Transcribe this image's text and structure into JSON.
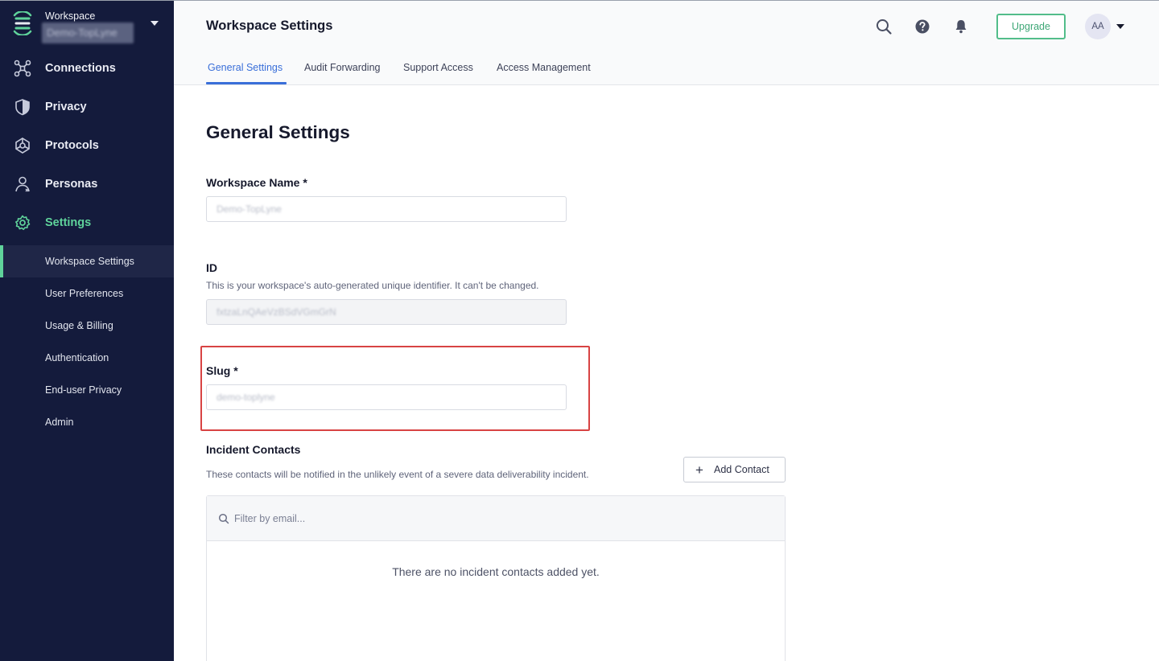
{
  "workspace": {
    "label": "Workspace",
    "name": "Demo-TopLyne"
  },
  "sidebar": {
    "nav": [
      {
        "label": "Connections"
      },
      {
        "label": "Privacy"
      },
      {
        "label": "Protocols"
      },
      {
        "label": "Personas"
      },
      {
        "label": "Settings"
      }
    ],
    "sub": [
      {
        "label": "Workspace Settings"
      },
      {
        "label": "User Preferences"
      },
      {
        "label": "Usage & Billing"
      },
      {
        "label": "Authentication"
      },
      {
        "label": "End-user Privacy"
      },
      {
        "label": "Admin"
      }
    ],
    "accent_color": "#5fd39b"
  },
  "header": {
    "title": "Workspace Settings",
    "upgrade_label": "Upgrade",
    "avatar_initials": "AA",
    "tabs": [
      {
        "label": "General Settings"
      },
      {
        "label": "Audit Forwarding"
      },
      {
        "label": "Support Access"
      },
      {
        "label": "Access Management"
      }
    ]
  },
  "main": {
    "title": "General Settings",
    "workspace_name": {
      "label": "Workspace Name *",
      "value": "Demo-TopLyne"
    },
    "id": {
      "label": "ID",
      "help": "This is your workspace's auto-generated unique identifier. It can't be changed.",
      "value": "fxtzaLnQAeVzBSdVGmGrN"
    },
    "slug": {
      "label": "Slug *",
      "value": "demo-toplyne"
    },
    "incident_contacts": {
      "title": "Incident Contacts",
      "help": "These contacts will be notified in the unlikely event of a severe data deliverability incident.",
      "add_label": "Add Contact",
      "filter_placeholder": "Filter by email...",
      "empty_message": "There are no incident contacts added yet."
    }
  },
  "colors": {
    "sidebar_bg": "#141b3c",
    "tab_active": "#3a6fd9",
    "upgrade": "#52bd8a",
    "highlight": "#d84343"
  }
}
